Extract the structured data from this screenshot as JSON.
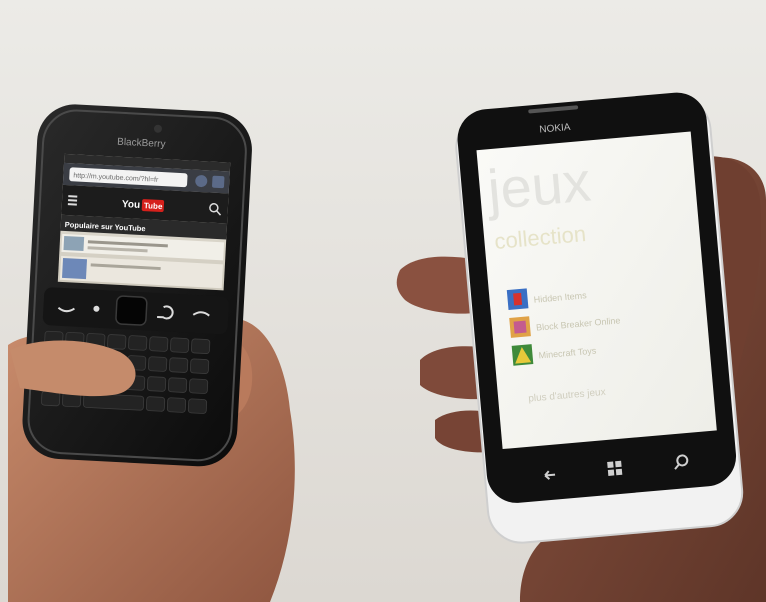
{
  "photo": {
    "blackberry": {
      "brand": "BlackBerry",
      "browser": {
        "url": "http://m.youtube.com/?hl=fr",
        "site_logo_you": "You",
        "site_logo_tube": "Tube",
        "section_heading": "Populaire sur YouTube"
      }
    },
    "nokia": {
      "brand": "NOKIA",
      "screen": {
        "title": "jeux",
        "subtitle": "collection",
        "games": [
          "Hidden Items",
          "Block Breaker Online",
          "Minecraft Toys"
        ],
        "more_link": "plus d'autres jeux"
      }
    },
    "colors": {
      "background": "#e6e3de",
      "phone_body": "#111111",
      "nokia_white": "#f2f2f2",
      "skin": "#a86a4e",
      "youtube_red": "#d6201b",
      "wp_screen": "#f7f7f4"
    }
  }
}
